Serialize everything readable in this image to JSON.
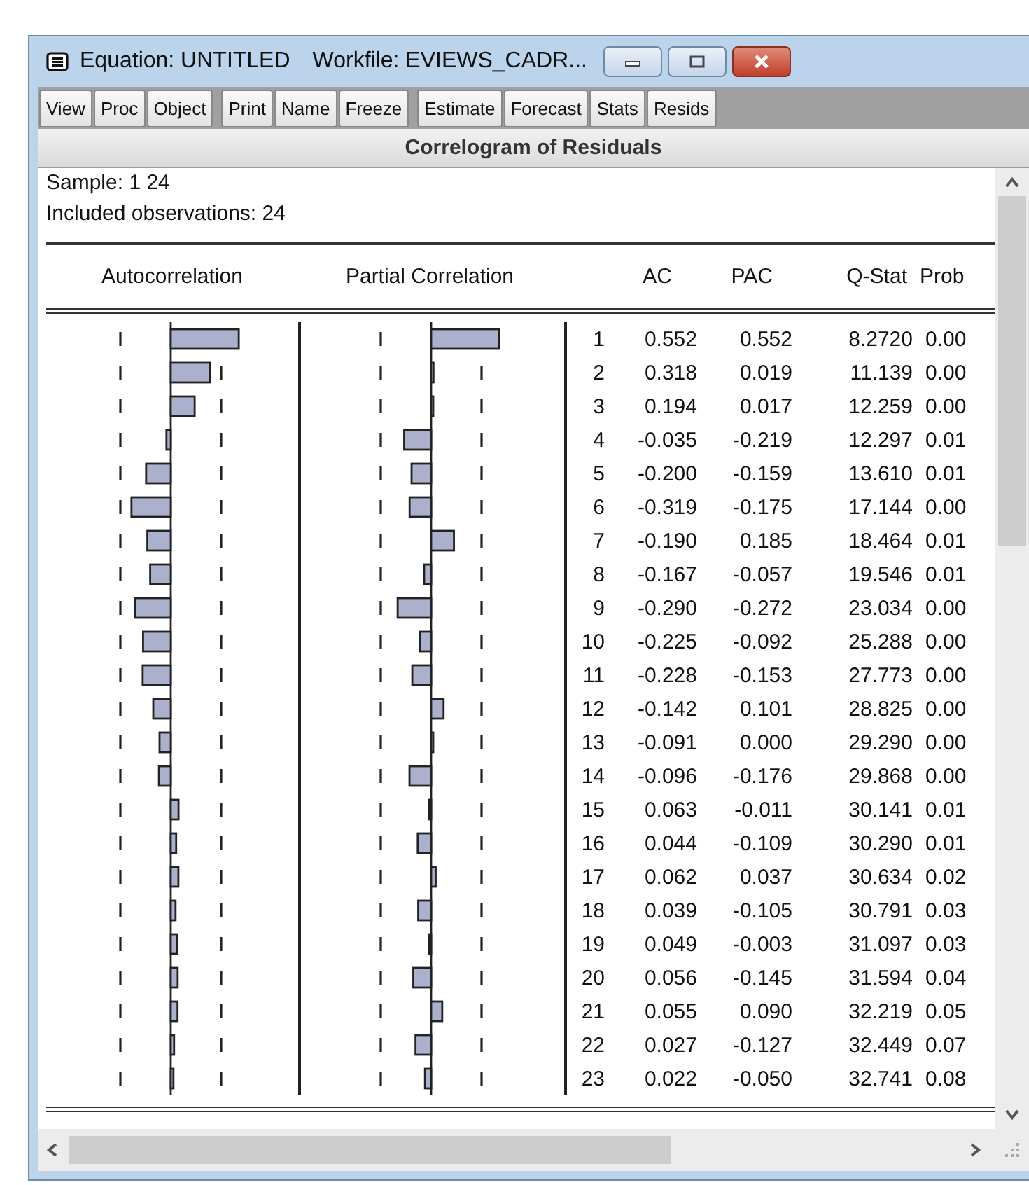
{
  "window": {
    "title": "Equation: UNTITLED",
    "workfile": "Workfile: EVIEWS_CADR..."
  },
  "toolbar": [
    [
      "View",
      "Proc",
      "Object"
    ],
    [
      "Print",
      "Name",
      "Freeze"
    ],
    [
      "Estimate",
      "Forecast",
      "Stats",
      "Resids"
    ]
  ],
  "view_title": "Correlogram of Residuals",
  "sample": "Sample: 1 24",
  "observations": "Included observations: 24",
  "columns": [
    "Autocorrelation",
    "Partial Correlation",
    "AC",
    "PAC",
    "Q-Stat",
    "Prob"
  ],
  "rows": [
    {
      "lag": "1",
      "ac": "0.552",
      "pac": "0.552",
      "q_stat": "8.2720",
      "prob": "0.00"
    },
    {
      "lag": "2",
      "ac": "0.318",
      "pac": "0.019",
      "q_stat": "11.139",
      "prob": "0.00"
    },
    {
      "lag": "3",
      "ac": "0.194",
      "pac": "0.017",
      "q_stat": "12.259",
      "prob": "0.00"
    },
    {
      "lag": "4",
      "ac": "-0.035",
      "pac": "-0.219",
      "q_stat": "12.297",
      "prob": "0.01"
    },
    {
      "lag": "5",
      "ac": "-0.200",
      "pac": "-0.159",
      "q_stat": "13.610",
      "prob": "0.01"
    },
    {
      "lag": "6",
      "ac": "-0.319",
      "pac": "-0.175",
      "q_stat": "17.144",
      "prob": "0.00"
    },
    {
      "lag": "7",
      "ac": "-0.190",
      "pac": "0.185",
      "q_stat": "18.464",
      "prob": "0.01"
    },
    {
      "lag": "8",
      "ac": "-0.167",
      "pac": "-0.057",
      "q_stat": "19.546",
      "prob": "0.01"
    },
    {
      "lag": "9",
      "ac": "-0.290",
      "pac": "-0.272",
      "q_stat": "23.034",
      "prob": "0.00"
    },
    {
      "lag": "10",
      "ac": "-0.225",
      "pac": "-0.092",
      "q_stat": "25.288",
      "prob": "0.00"
    },
    {
      "lag": "11",
      "ac": "-0.228",
      "pac": "-0.153",
      "q_stat": "27.773",
      "prob": "0.00"
    },
    {
      "lag": "12",
      "ac": "-0.142",
      "pac": "0.101",
      "q_stat": "28.825",
      "prob": "0.00"
    },
    {
      "lag": "13",
      "ac": "-0.091",
      "pac": "0.000",
      "q_stat": "29.290",
      "prob": "0.00"
    },
    {
      "lag": "14",
      "ac": "-0.096",
      "pac": "-0.176",
      "q_stat": "29.868",
      "prob": "0.00"
    },
    {
      "lag": "15",
      "ac": "0.063",
      "pac": "-0.011",
      "q_stat": "30.141",
      "prob": "0.01"
    },
    {
      "lag": "16",
      "ac": "0.044",
      "pac": "-0.109",
      "q_stat": "30.290",
      "prob": "0.01"
    },
    {
      "lag": "17",
      "ac": "0.062",
      "pac": "0.037",
      "q_stat": "30.634",
      "prob": "0.02"
    },
    {
      "lag": "18",
      "ac": "0.039",
      "pac": "-0.105",
      "q_stat": "30.791",
      "prob": "0.03"
    },
    {
      "lag": "19",
      "ac": "0.049",
      "pac": "-0.003",
      "q_stat": "31.097",
      "prob": "0.03"
    },
    {
      "lag": "20",
      "ac": "0.056",
      "pac": "-0.145",
      "q_stat": "31.594",
      "prob": "0.04"
    },
    {
      "lag": "21",
      "ac": "0.055",
      "pac": "0.090",
      "q_stat": "32.219",
      "prob": "0.05"
    },
    {
      "lag": "22",
      "ac": "0.027",
      "pac": "-0.127",
      "q_stat": "32.449",
      "prob": "0.07"
    },
    {
      "lag": "23",
      "ac": "0.022",
      "pac": "-0.050",
      "q_stat": "32.741",
      "prob": "0.08"
    }
  ]
}
